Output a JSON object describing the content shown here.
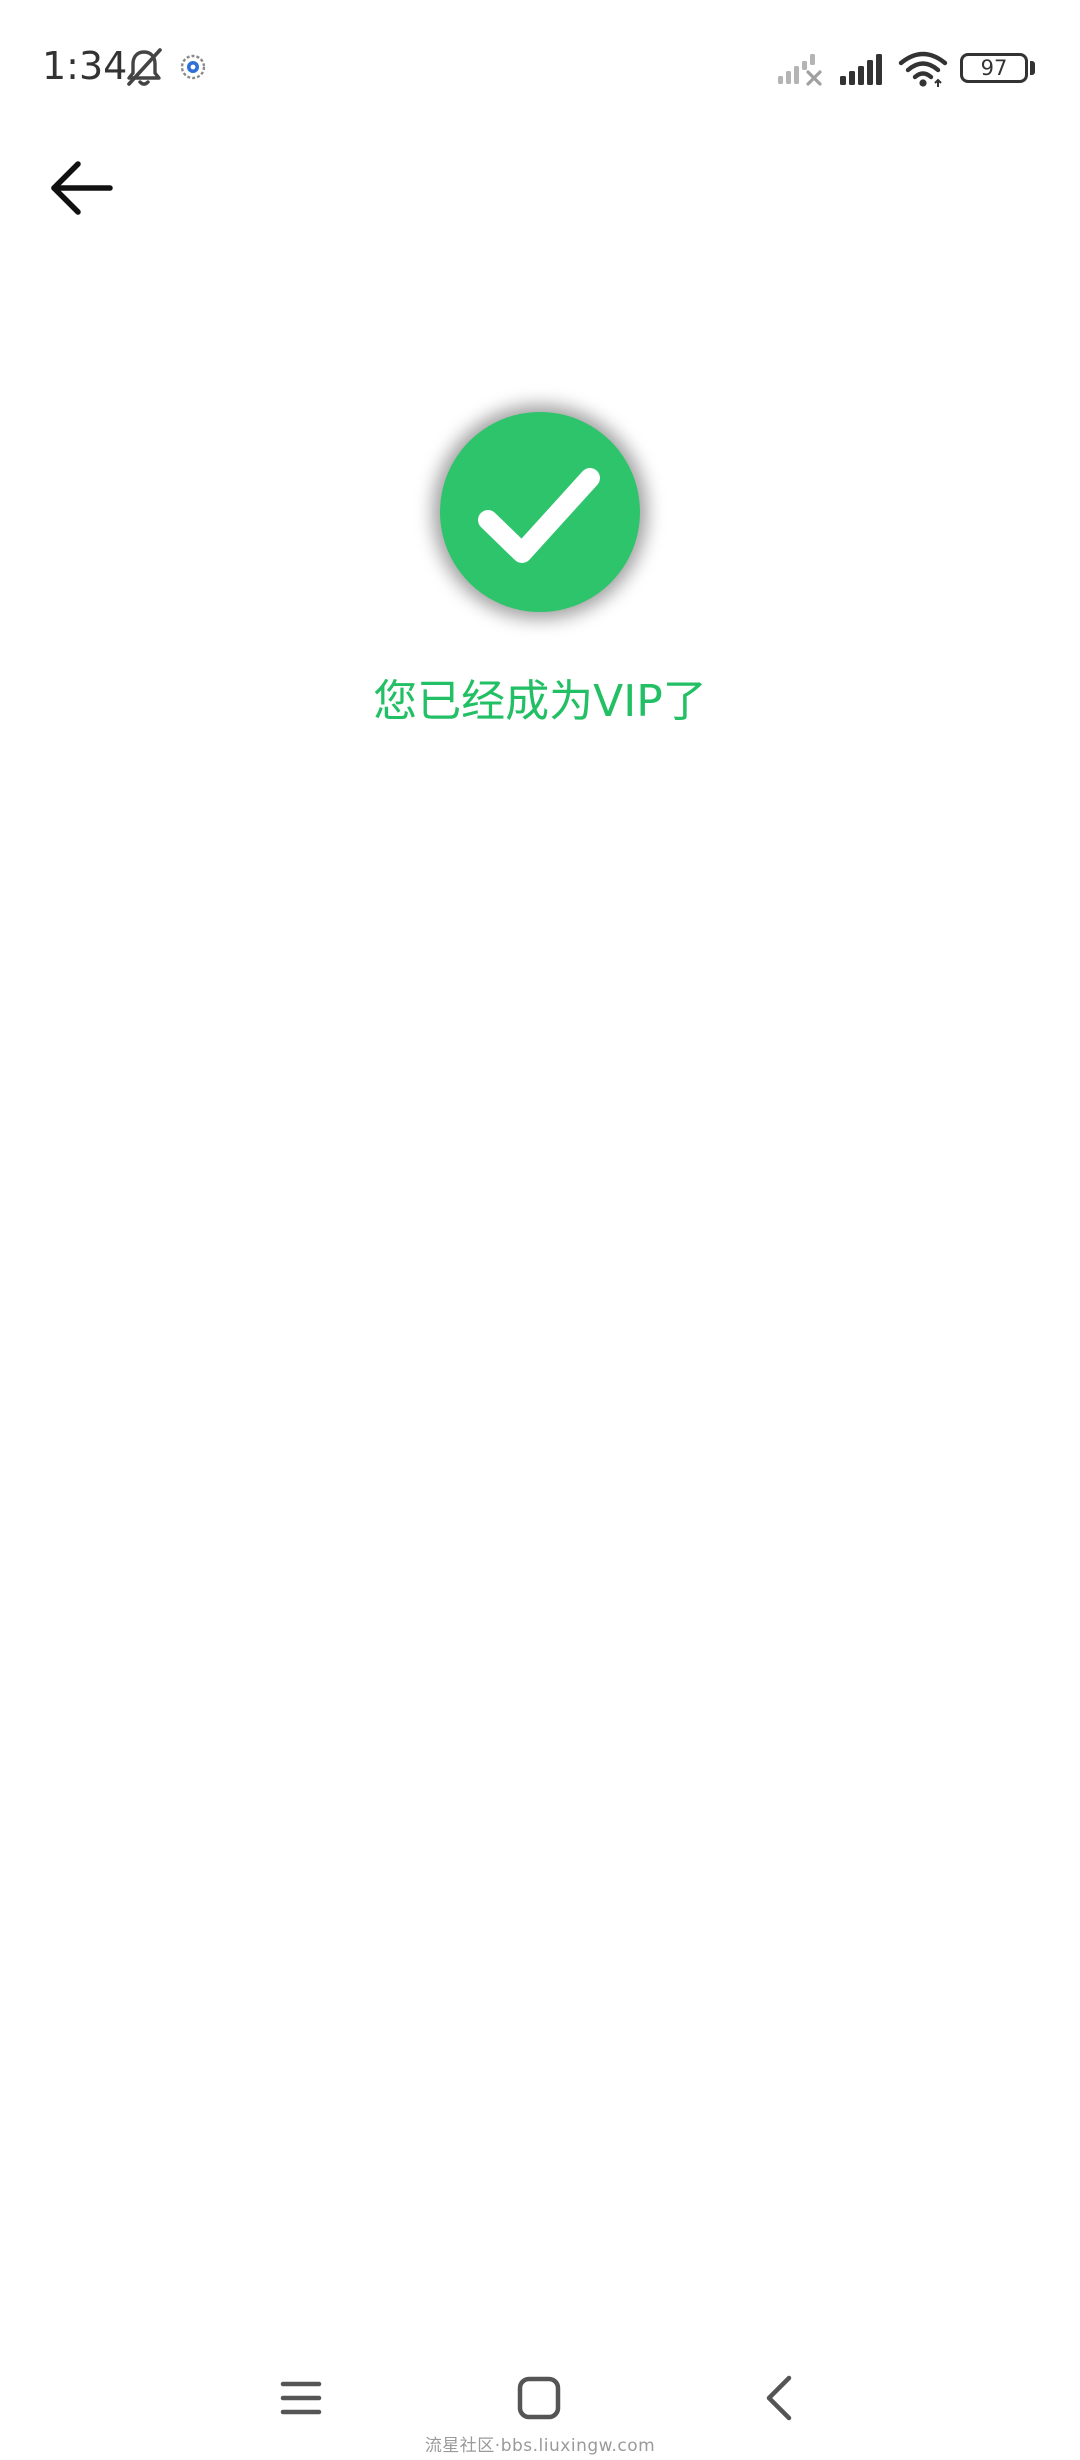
{
  "status_bar": {
    "time": "1:34",
    "icons": [
      "bell-off-icon",
      "app-notification-icon",
      "signal-no-service-icon",
      "signal-strength-icon",
      "wifi-icon"
    ],
    "battery_level": "97"
  },
  "header": {
    "back_icon": "arrow-left-icon"
  },
  "success": {
    "icon": "checkmark-icon",
    "message": "您已经成为VIP了",
    "circle_color": "#2ec46b",
    "text_color": "#22bf64"
  },
  "nav_bar": {
    "items": [
      "menu-icon",
      "home-icon",
      "back-icon"
    ]
  },
  "watermark": "流星社区·bbs.liuxingw.com"
}
